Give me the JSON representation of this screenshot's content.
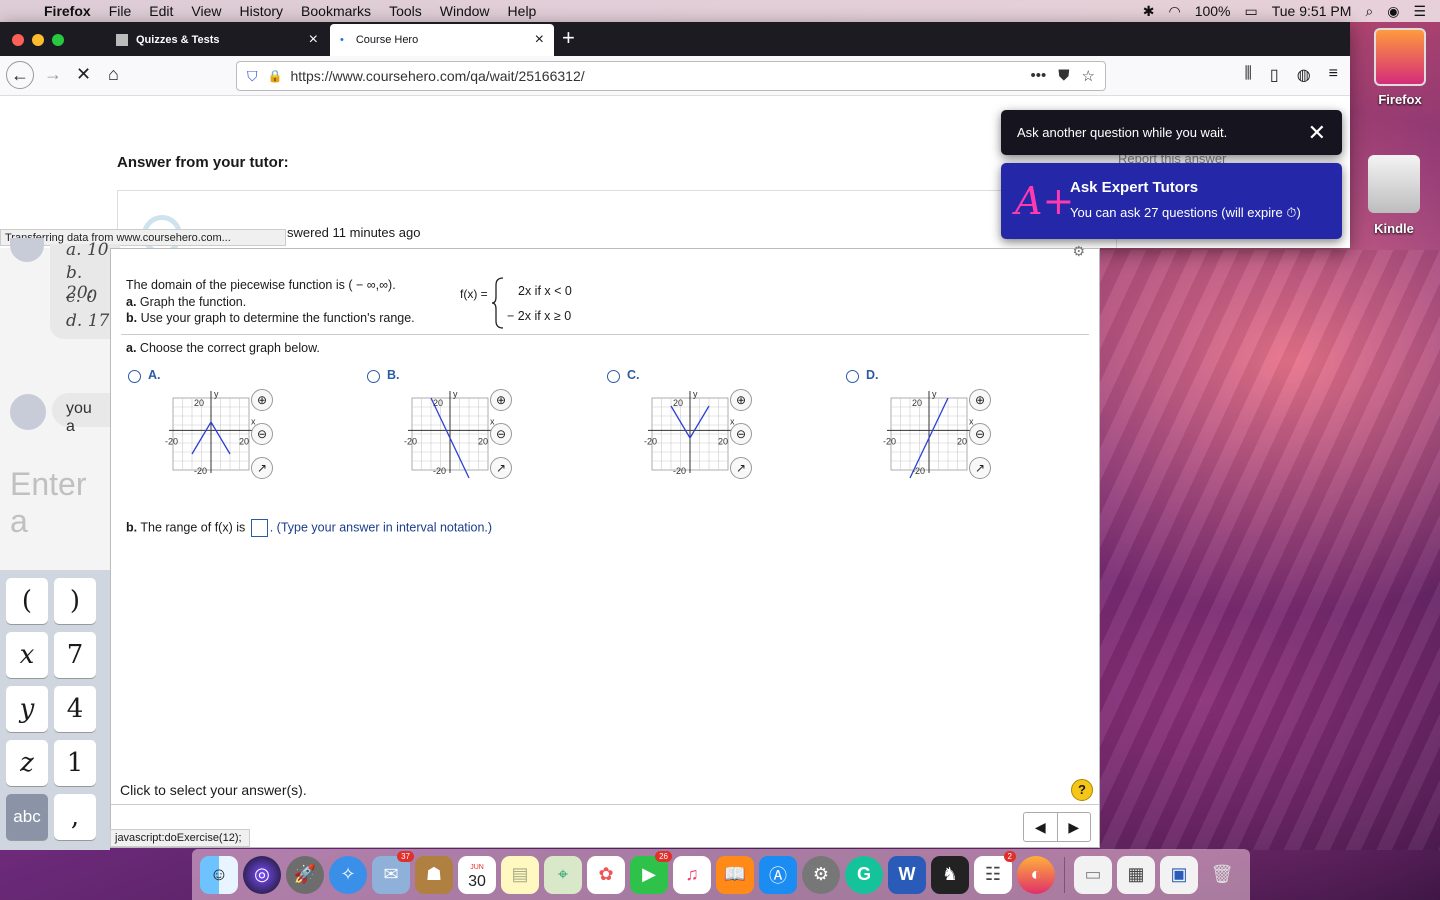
{
  "menubar": {
    "app": "Firefox",
    "items": [
      "File",
      "Edit",
      "View",
      "History",
      "Bookmarks",
      "Tools",
      "Window",
      "Help"
    ],
    "battery": "100%",
    "clock": "Tue 9:51 PM"
  },
  "browser": {
    "tabs": [
      {
        "label": "Quizzes & Tests"
      },
      {
        "label": "Course Hero"
      }
    ],
    "url": "https://www.coursehero.com/qa/wait/25166312/",
    "status": "Transferring data from www.coursehero.com..."
  },
  "page": {
    "answer_title": "Answer from your tutor:",
    "answered": "swered 11 minutes ago",
    "report": "Report this answer"
  },
  "toasts": {
    "ask_another": "Ask another question while you wait.",
    "expert_title": "Ask Expert Tutors",
    "expert_sub": "You can ask 27 questions (will expire ⏱)"
  },
  "desktop": {
    "icons": [
      "Firefox",
      "Kindle"
    ]
  },
  "chat": {
    "lines": [
      "a. 10",
      "b. 20:",
      "c. 0",
      "d. 17"
    ],
    "you": "you a",
    "enter": "Enter a"
  },
  "keypad": {
    "keys": [
      "(",
      ")",
      "x",
      "7",
      "y",
      "4",
      "z",
      "1",
      "abc",
      ","
    ]
  },
  "problem": {
    "q1": "The domain of the piecewise function is ( − ∞,∞).",
    "q2_label": "a.",
    "q2": " Graph the function.",
    "q3_label": "b.",
    "q3": " Use your graph to determine the function's range.",
    "fx": "f(x) =",
    "case1": "2x  if  x < 0",
    "case2": "− 2x  if  x ≥ 0",
    "parta_label": "a.",
    "parta": " Choose the correct graph below.",
    "options": [
      {
        "label": "A."
      },
      {
        "label": "B."
      },
      {
        "label": "C."
      },
      {
        "label": "D."
      }
    ],
    "axis": {
      "y": "y",
      "x": "x",
      "pos": "20",
      "neg": "-20"
    },
    "partb_label": "b.",
    "partb": " The range of f(x) is ",
    "partb_hint": ". (Type your answer in interval notation.)",
    "click": "Click to select your answer(s).",
    "help": "?",
    "js_status": "javascript:doExercise(12);"
  },
  "dock": {
    "badges": {
      "mail": "37",
      "facetime": "26",
      "reminders": "2"
    },
    "calendar_month": "JUN",
    "calendar_day": "30"
  }
}
